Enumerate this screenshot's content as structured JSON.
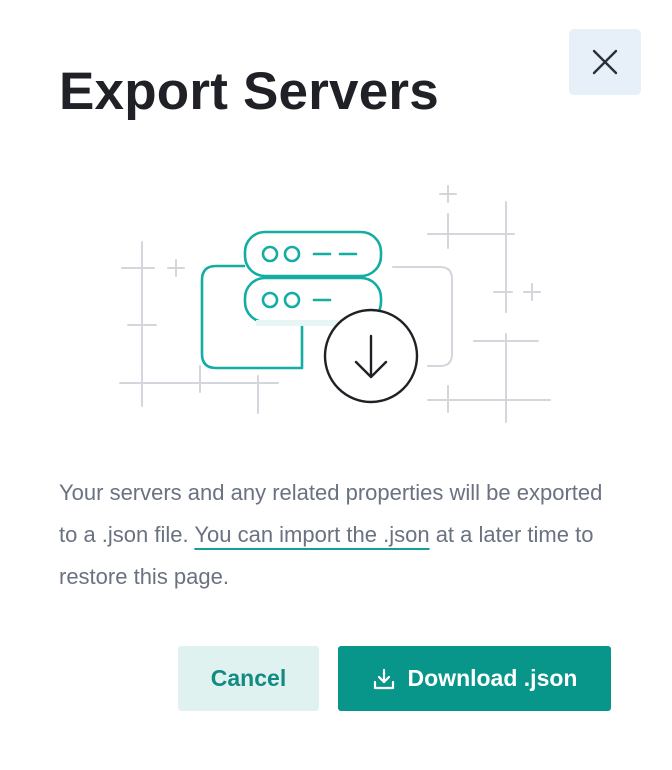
{
  "dialog": {
    "title": "Export Servers",
    "close_icon": "close-icon",
    "body_text_before": "Your servers and any related properties will be exported to a .json file. ",
    "body_link": "You can import the .json",
    "body_text_after": " at a later time to restore this page.",
    "cancel_label": "Cancel",
    "download_label": "Download .json",
    "download_icon": "download-icon",
    "illustration_icon": "server-export-illustration"
  },
  "colors": {
    "accent": "#08968b",
    "accent_light": "#e0f2ef",
    "title": "#1f2126",
    "body": "#6a7281",
    "close_bg": "#e7eff8"
  }
}
